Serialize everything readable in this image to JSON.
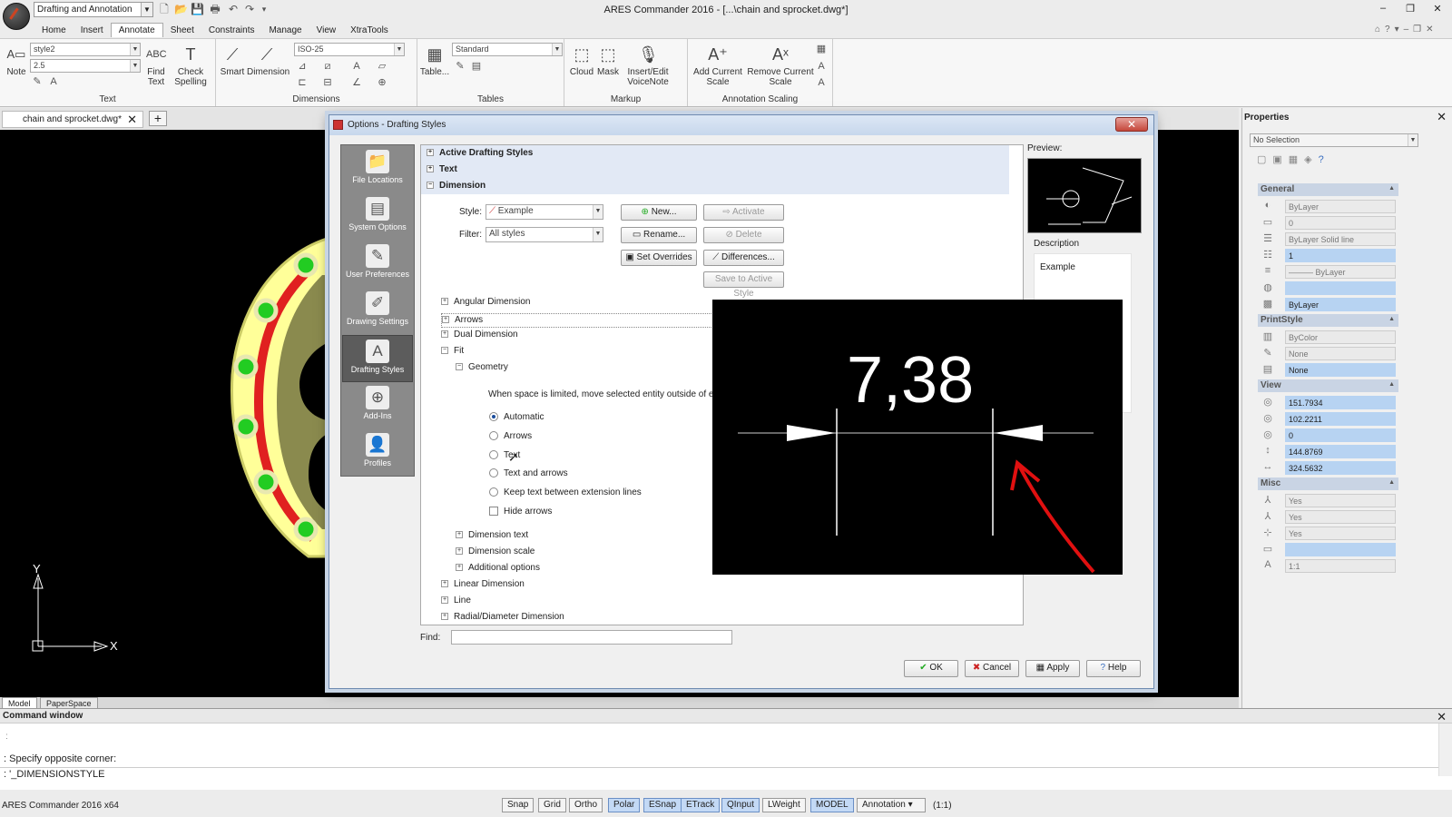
{
  "titlebar": {
    "workspace": "Drafting and Annotation",
    "app_title": "ARES Commander 2016 - [...\\chain and sprocket.dwg*]"
  },
  "menu_tabs": [
    "Home",
    "Insert",
    "Annotate",
    "Sheet",
    "Constraints",
    "Manage",
    "View",
    "XtraTools"
  ],
  "ribbon": {
    "text_group": {
      "label": "Text",
      "note": "Note",
      "style": "style2",
      "height": "2.5",
      "find_text": "Find\nText",
      "check_spelling": "Check\nSpelling"
    },
    "dimensions_group": {
      "label": "Dimensions",
      "smart": "Smart",
      "dimension": "Dimension",
      "dim_style": "ISO-25"
    },
    "tables_group": {
      "label": "Tables",
      "table": "Table...",
      "table_style": "Standard"
    },
    "markup_group": {
      "label": "Markup",
      "cloud": "Cloud",
      "mask": "Mask",
      "voicenote": "Insert/Edit\nVoiceNote"
    },
    "scaling_group": {
      "label": "Annotation Scaling",
      "add_scale": "Add Current\nScale",
      "remove_scale": "Remove Current\nScale"
    }
  },
  "document_tab": "chain and sprocket.dwg*",
  "model_tabs": [
    "Model",
    "PaperSpace"
  ],
  "axes": {
    "x": "X",
    "y": "Y"
  },
  "properties": {
    "title": "Properties",
    "selection": "No Selection",
    "sections": {
      "general": {
        "title": "General",
        "rows": [
          "ByLayer",
          "0",
          "ByLayer     Solid line",
          "1",
          "——— ByLayer",
          "",
          "ByLayer"
        ]
      },
      "printstyle": {
        "title": "PrintStyle",
        "rows": [
          "ByColor",
          "None",
          "None"
        ]
      },
      "view": {
        "title": "View",
        "rows": [
          "151.7934",
          "102.2211",
          "0",
          "144.8769",
          "324.5632"
        ]
      },
      "misc": {
        "title": "Misc",
        "rows": [
          "Yes",
          "Yes",
          "Yes",
          "",
          "1:1"
        ]
      }
    }
  },
  "dialog": {
    "title": "Options - Drafting Styles",
    "nav": [
      "File Locations",
      "System Options",
      "User Preferences",
      "Drawing Settings",
      "Drafting Styles",
      "Add-Ins",
      "Profiles"
    ],
    "sections": [
      "Active Drafting Styles",
      "Text",
      "Dimension"
    ],
    "style_label": "Style:",
    "style_value": "Example",
    "filter_label": "Filter:",
    "filter_value": "All styles",
    "buttons": {
      "new": "New...",
      "activate": "Activate",
      "rename": "Rename...",
      "delete": "Delete",
      "set_overrides": "Set Overrides",
      "differences": "Differences...",
      "save_active": "Save to Active Style"
    },
    "tree": [
      "Angular Dimension",
      "Arrows",
      "Dual Dimension",
      "Fit",
      "Geometry"
    ],
    "fit_prompt": "When space is limited, move selected entity outside of e",
    "options": [
      "Automatic",
      "Arrows",
      "Text",
      "Text and arrows",
      "Keep text between extension lines"
    ],
    "hide_arrows": "Hide arrows",
    "tree_after": [
      "Dimension text",
      "Dimension scale",
      "Additional options"
    ],
    "tree_bottom": [
      "Linear Dimension",
      "Line",
      "Radial/Diameter Dimension"
    ],
    "preview_label": "Preview:",
    "description_label": "Description",
    "description_value": "Example",
    "find_label": "Find:",
    "footer": {
      "ok": "OK",
      "cancel": "Cancel",
      "apply": "Apply",
      "help": "Help"
    }
  },
  "zoom_overlay": {
    "value": "7,38"
  },
  "command": {
    "title": "Command window",
    "line1": ": Specify opposite corner:",
    "line2": ": '_DIMENSIONSTYLE",
    "app_version": "ARES Commander 2016 x64"
  },
  "status_buttons": [
    "Snap",
    "Grid",
    "Ortho",
    "Polar",
    "ESnap",
    "ETrack",
    "QInput",
    "LWeight",
    "MODEL"
  ],
  "status_annotation": "Annotation",
  "status_scale": "(1:1)"
}
